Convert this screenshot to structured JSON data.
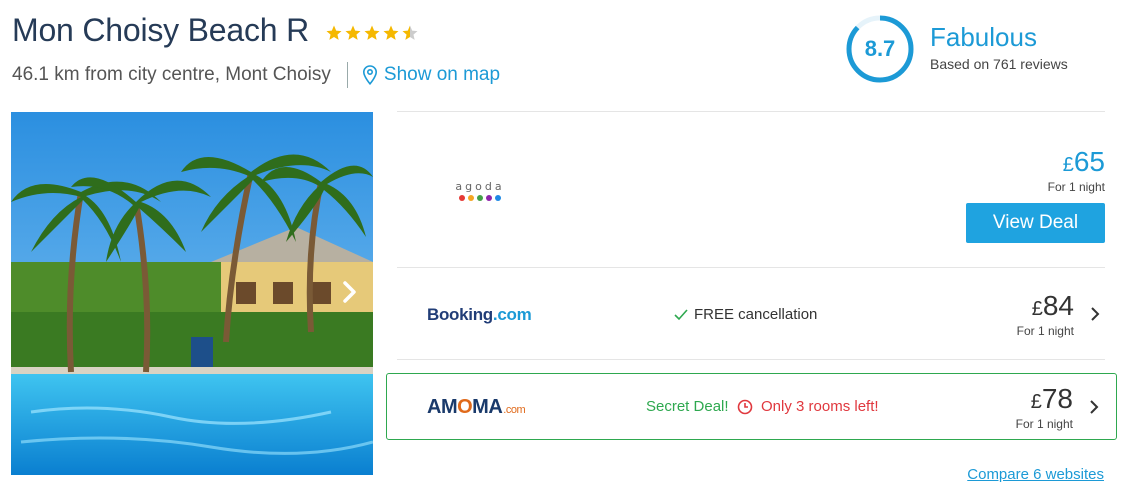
{
  "hotel": {
    "name": "Mon Choisy Beach R",
    "stars": 4.5,
    "distance": "46.1 km from city centre, Mont Choisy",
    "map_link": "Show on map"
  },
  "rating": {
    "score": "8.7",
    "label": "Fabulous",
    "reviews": "Based on 761 reviews"
  },
  "deals": [
    {
      "provider": "agoda",
      "currency": "£",
      "price": "65",
      "per_night": "For 1 night",
      "cta": "View Deal"
    },
    {
      "provider": "Booking.com",
      "currency": "£",
      "price": "84",
      "per_night": "For 1 night",
      "note": "FREE cancellation"
    },
    {
      "provider": "AMOMA.com",
      "currency": "£",
      "price": "78",
      "per_night": "For 1 night",
      "secret": "Secret Deal!",
      "urgency": "Only 3 rooms left!"
    }
  ],
  "booking_logo": {
    "main": "Booking",
    "suffix": ".com"
  },
  "amoma_logo": {
    "a": "AM",
    "o": "O",
    "b": "MA",
    "suffix": ".com"
  },
  "compare_link": "Compare 6 websites",
  "colors": {
    "accent": "#1c9ad6",
    "button": "#1fa3e0",
    "green": "#2ea84f",
    "red": "#e0383e",
    "title": "#263b57"
  }
}
